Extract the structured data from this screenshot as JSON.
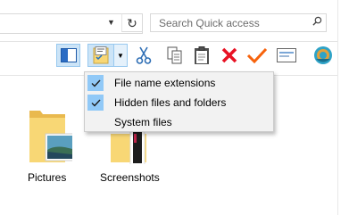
{
  "search": {
    "placeholder": "Search Quick access"
  },
  "toolbar": {
    "buttons": [
      {
        "name": "preview-pane",
        "icon": "preview-pane-icon"
      },
      {
        "name": "view-options",
        "icon": "view-options-icon"
      },
      {
        "name": "view-options-dropdown",
        "icon": "chevron-down-icon"
      },
      {
        "name": "cut",
        "icon": "scissors-icon"
      },
      {
        "name": "copy",
        "icon": "copy-icon"
      },
      {
        "name": "paste",
        "icon": "clipboard-icon"
      },
      {
        "name": "delete",
        "icon": "red-x-icon"
      },
      {
        "name": "select",
        "icon": "checkmark-icon"
      },
      {
        "name": "properties",
        "icon": "envelope-icon"
      },
      {
        "name": "network",
        "icon": "globe-icon"
      }
    ]
  },
  "menu": {
    "items": [
      {
        "label": "File name extensions",
        "checked": true
      },
      {
        "label": "Hidden files and folders",
        "checked": true
      },
      {
        "label": "System files",
        "checked": false
      }
    ]
  },
  "files": [
    {
      "label": "Pictures"
    },
    {
      "label": "Screenshots"
    }
  ],
  "colors": {
    "selection": "#cce4f7",
    "menu_check": "#91c9f7",
    "delete_red": "#e81123",
    "check_orange": "#f7630c",
    "folder": "#f8d775"
  }
}
